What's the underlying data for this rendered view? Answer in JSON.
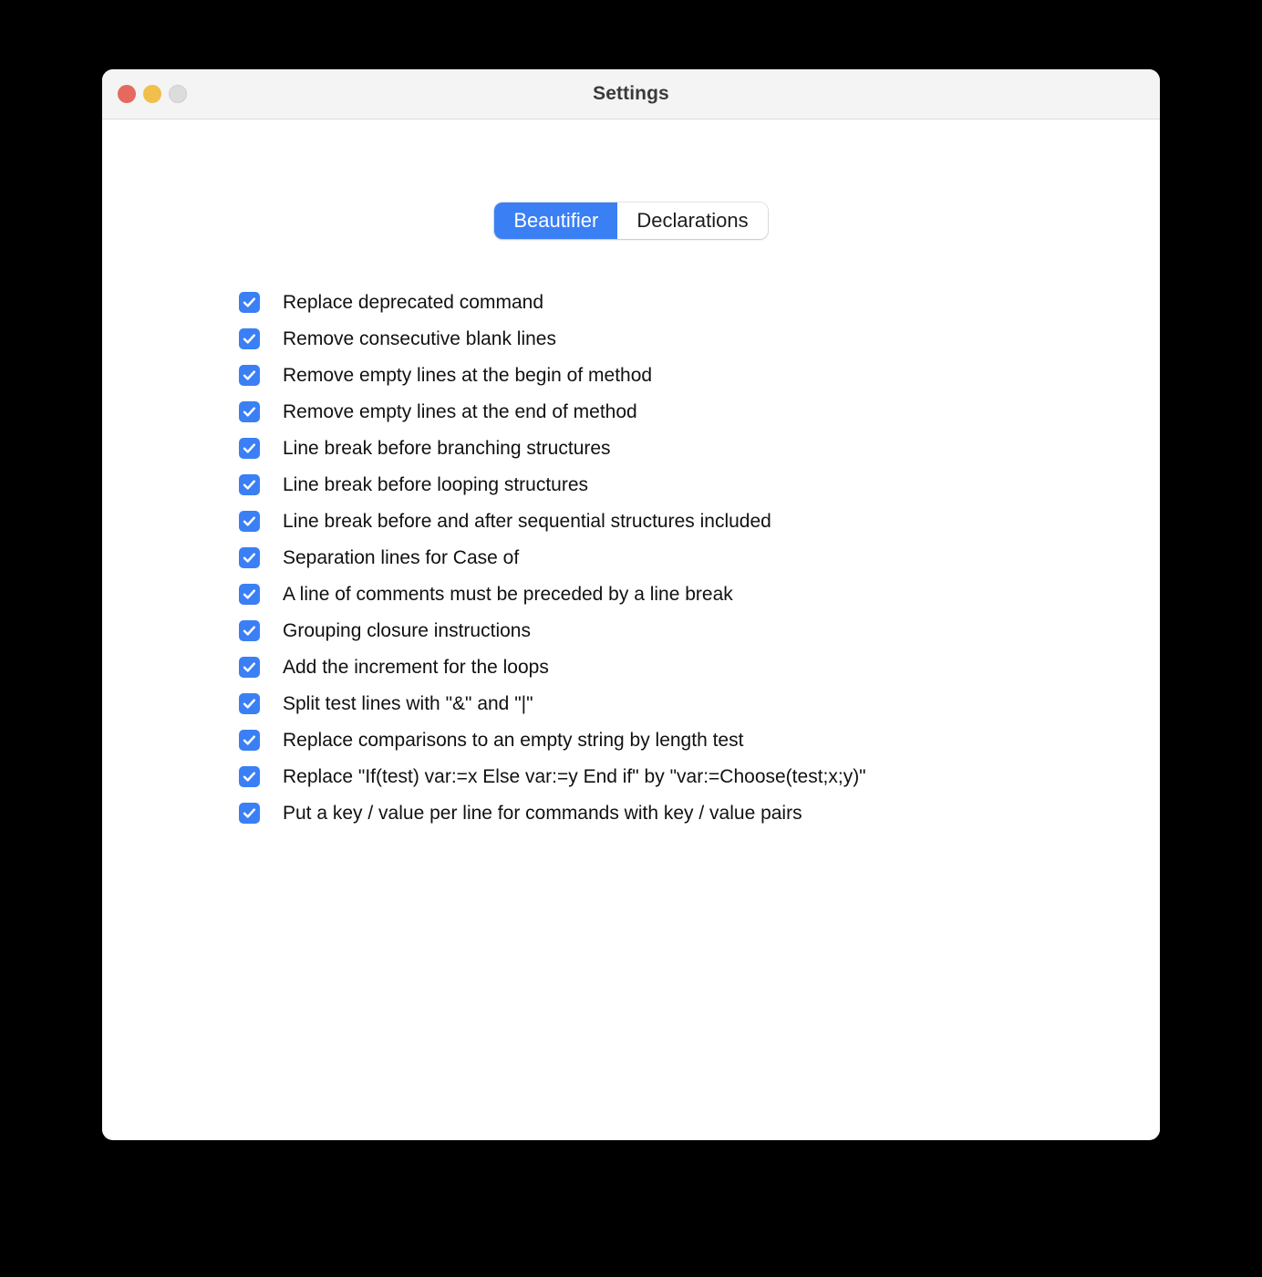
{
  "window": {
    "title": "Settings",
    "traffic_lights": [
      {
        "name": "close",
        "color": "#e5695f"
      },
      {
        "name": "minimize",
        "color": "#f0bf4c"
      },
      {
        "name": "zoom",
        "color": "#dcdcdc"
      }
    ]
  },
  "tabs": {
    "selected": "Beautifier",
    "items": [
      {
        "label": "Beautifier",
        "selected": true
      },
      {
        "label": "Declarations",
        "selected": false
      }
    ]
  },
  "options": [
    {
      "label": "Replace deprecated command",
      "checked": true
    },
    {
      "label": "Remove consecutive blank lines",
      "checked": true
    },
    {
      "label": "Remove empty lines at the begin of method",
      "checked": true
    },
    {
      "label": "Remove empty lines at the end of method",
      "checked": true
    },
    {
      "label": "Line break before branching structures",
      "checked": true
    },
    {
      "label": "Line break before looping structures",
      "checked": true
    },
    {
      "label": "Line break before and after sequential structures included",
      "checked": true
    },
    {
      "label": "Separation lines for Case of",
      "checked": true
    },
    {
      "label": "A line of comments must be preceded by a line break",
      "checked": true
    },
    {
      "label": "Grouping closure instructions",
      "checked": true
    },
    {
      "label": "Add the increment for the loops",
      "checked": true
    },
    {
      "label": "Split test lines with \"&\" and \"|\"",
      "checked": true
    },
    {
      "label": "Replace comparisons to an empty string by length test",
      "checked": true
    },
    {
      "label": "Replace \"If(test) var:=x Else var:=y End if\" by \"var:=Choose(test;x;y)\"",
      "checked": true
    },
    {
      "label": "Put a key / value per line for commands with key / value pairs",
      "checked": true
    }
  ],
  "colors": {
    "accent": "#3b7ff5",
    "titlebar_bg": "#f4f4f4",
    "content_bg": "#ffffff",
    "desktop_bg": "#000000",
    "text": "#111111"
  }
}
